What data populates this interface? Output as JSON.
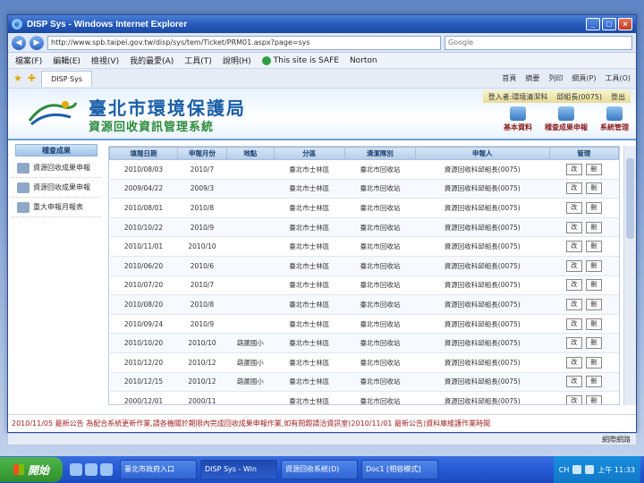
{
  "window": {
    "title": "DISP Sys - Windows Internet Explorer",
    "controls": [
      "_",
      "□",
      "×"
    ]
  },
  "address": {
    "back": "◀",
    "forward": "▶",
    "url": "http://www.spb.taipei.gov.tw/disp/sys/tem/Ticket/PRM01.aspx?page=sys",
    "search_placeholder": "Google"
  },
  "menu": [
    "檔案(F)",
    "編輯(E)",
    "檢視(V)",
    "我的最愛(A)",
    "工具(T)",
    "說明(H)"
  ],
  "safety": {
    "text": "This site is SAFE",
    "extra": "Norton"
  },
  "favbar": {
    "tab": "DISP Sys",
    "tools": [
      "首頁",
      "摘要",
      "列印",
      "網頁(P)",
      "工具(O)"
    ]
  },
  "site": {
    "title": "臺北市環境保護局",
    "subtitle": "資源回收資訊管理系統",
    "user_info": [
      "登入者:環境清潔科",
      "邱組長(0075)",
      "登出"
    ],
    "top_nav": [
      "基本資料",
      "稽查成果申報",
      "系統管理"
    ]
  },
  "sidebar": {
    "header": "稽查成果",
    "items": [
      "資源回收成果申報",
      "資源回收成果申報",
      "重大申報月報表"
    ]
  },
  "table": {
    "headers": [
      "填報日期",
      "申報月份",
      "地點",
      "分區",
      "清潔隊別",
      "申報人",
      "管理"
    ],
    "actions": [
      "改",
      "刪"
    ],
    "rows": [
      [
        "2010/08/03",
        "2010/7",
        "",
        "臺北市士林區",
        "臺北市回收站",
        "資源回收科邱組長(0075)"
      ],
      [
        "2009/04/22",
        "2009/3",
        "",
        "臺北市士林區",
        "臺北市回收站",
        "資源回收科邱組長(0075)"
      ],
      [
        "2010/08/01",
        "2010/8",
        "",
        "臺北市士林區",
        "臺北市回收站",
        "資源回收科邱組長(0075)"
      ],
      [
        "2010/10/22",
        "2010/9",
        "",
        "臺北市士林區",
        "臺北市回收站",
        "資源回收科邱組長(0075)"
      ],
      [
        "2010/11/01",
        "2010/10",
        "",
        "臺北市士林區",
        "臺北市回收站",
        "資源回收科邱組長(0075)"
      ],
      [
        "2010/06/20",
        "2010/6",
        "",
        "臺北市士林區",
        "臺北市回收站",
        "資源回收科邱組長(0075)"
      ],
      [
        "2010/07/20",
        "2010/7",
        "",
        "臺北市士林區",
        "臺北市回收站",
        "資源回收科邱組長(0075)"
      ],
      [
        "2010/08/20",
        "2010/8",
        "",
        "臺北市士林區",
        "臺北市回收站",
        "資源回收科邱組長(0075)"
      ],
      [
        "2010/09/24",
        "2010/9",
        "",
        "臺北市士林區",
        "臺北市回收站",
        "資源回收科邱組長(0075)"
      ],
      [
        "2010/10/20",
        "2010/10",
        "葫蘆國小",
        "臺北市士林區",
        "臺北市回收站",
        "資源回收科邱組長(0075)"
      ],
      [
        "2010/12/20",
        "2010/12",
        "葫蘆國小",
        "臺北市士林區",
        "臺北市回收站",
        "資源回收科邱組長(0075)"
      ],
      [
        "2010/12/15",
        "2010/12",
        "葫蘆國小",
        "臺北市士林區",
        "臺北市回收站",
        "資源回收科邱組長(0075)"
      ],
      [
        "2000/12/01",
        "2000/11",
        "",
        "臺北市士林區",
        "臺北市回收站",
        "資源回收科邱組長(0075)"
      ]
    ]
  },
  "marquee": "2010/11/05 最新公告 為配合系統更新作業,請各機關於期限內完成回收成果申報作業,如有問題請洽資訊室(2010/11/01 最新公告)資料庫維護作業時間",
  "status": "網際網路",
  "taskbar": {
    "start": "開始",
    "buttons": [
      "臺北市政府入口",
      "DISP Sys - Win",
      "資源回收系統(D)",
      "Doc1 [相容模式]",
      "CH"
    ],
    "clock": "上午 11:33"
  }
}
